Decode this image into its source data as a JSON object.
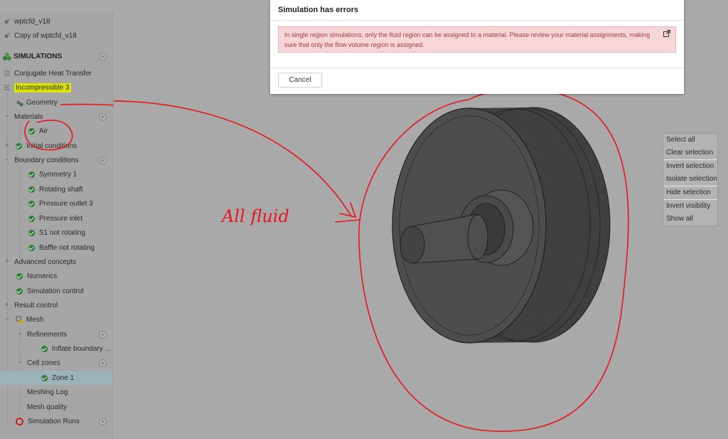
{
  "sidebar": {
    "files": [
      {
        "label": "wptcfd_v18"
      },
      {
        "label": "Copy of wptcfd_v18"
      }
    ],
    "section_title": "SIMULATIONS",
    "conjugate": "Conjugate Heat Transfer",
    "incompressible": "Incompressible 3",
    "geometry": "Geometry",
    "materials": "Materials",
    "air": "Air",
    "initial_conditions": "Initial conditions",
    "boundary_conditions": "Boundary conditions",
    "bc_items": [
      "Symmetry 1",
      "Rotating shaft",
      "Pressure outlet 3",
      "Pressure inlet",
      "S1 not rotating",
      "Baffle not rotating"
    ],
    "advanced_concepts": "Advanced concepts",
    "numerics": "Numerics",
    "simulation_control": "Simulation control",
    "result_control": "Result control",
    "mesh": "Mesh",
    "refinements": "Refinements",
    "inflate_boundary": "Inflate boundary ...",
    "cell_zones": "Cell zones",
    "zone1": "Zone 1",
    "meshing_log": "Meshing Log",
    "mesh_quality": "Mesh quality",
    "simulation_runs": "Simulation Runs"
  },
  "modal": {
    "title": "Simulation has errors",
    "message": "In single region simulations, only the fluid region can be assigned to a material. Please review your material assignments, making sure that only the flow volume region is assigned.",
    "cancel": "Cancel"
  },
  "selection_panel": {
    "items": [
      "Select all",
      "Clear selection",
      "Invert selection",
      "Isolate selection",
      "Hide selection",
      "Invert visibility",
      "Show all"
    ]
  },
  "annotations": {
    "handwritten_text": "All fluid",
    "question_mark": "?",
    "color": "#e8141c"
  },
  "colors": {
    "background": "#a9a9a9",
    "sidebar": "#a6a6a6",
    "highlight": "#dde300",
    "success": "#2e7d32",
    "error_bg": "#f7d6d8",
    "error_text": "#a63a3f",
    "model": "#4a4a4a"
  }
}
